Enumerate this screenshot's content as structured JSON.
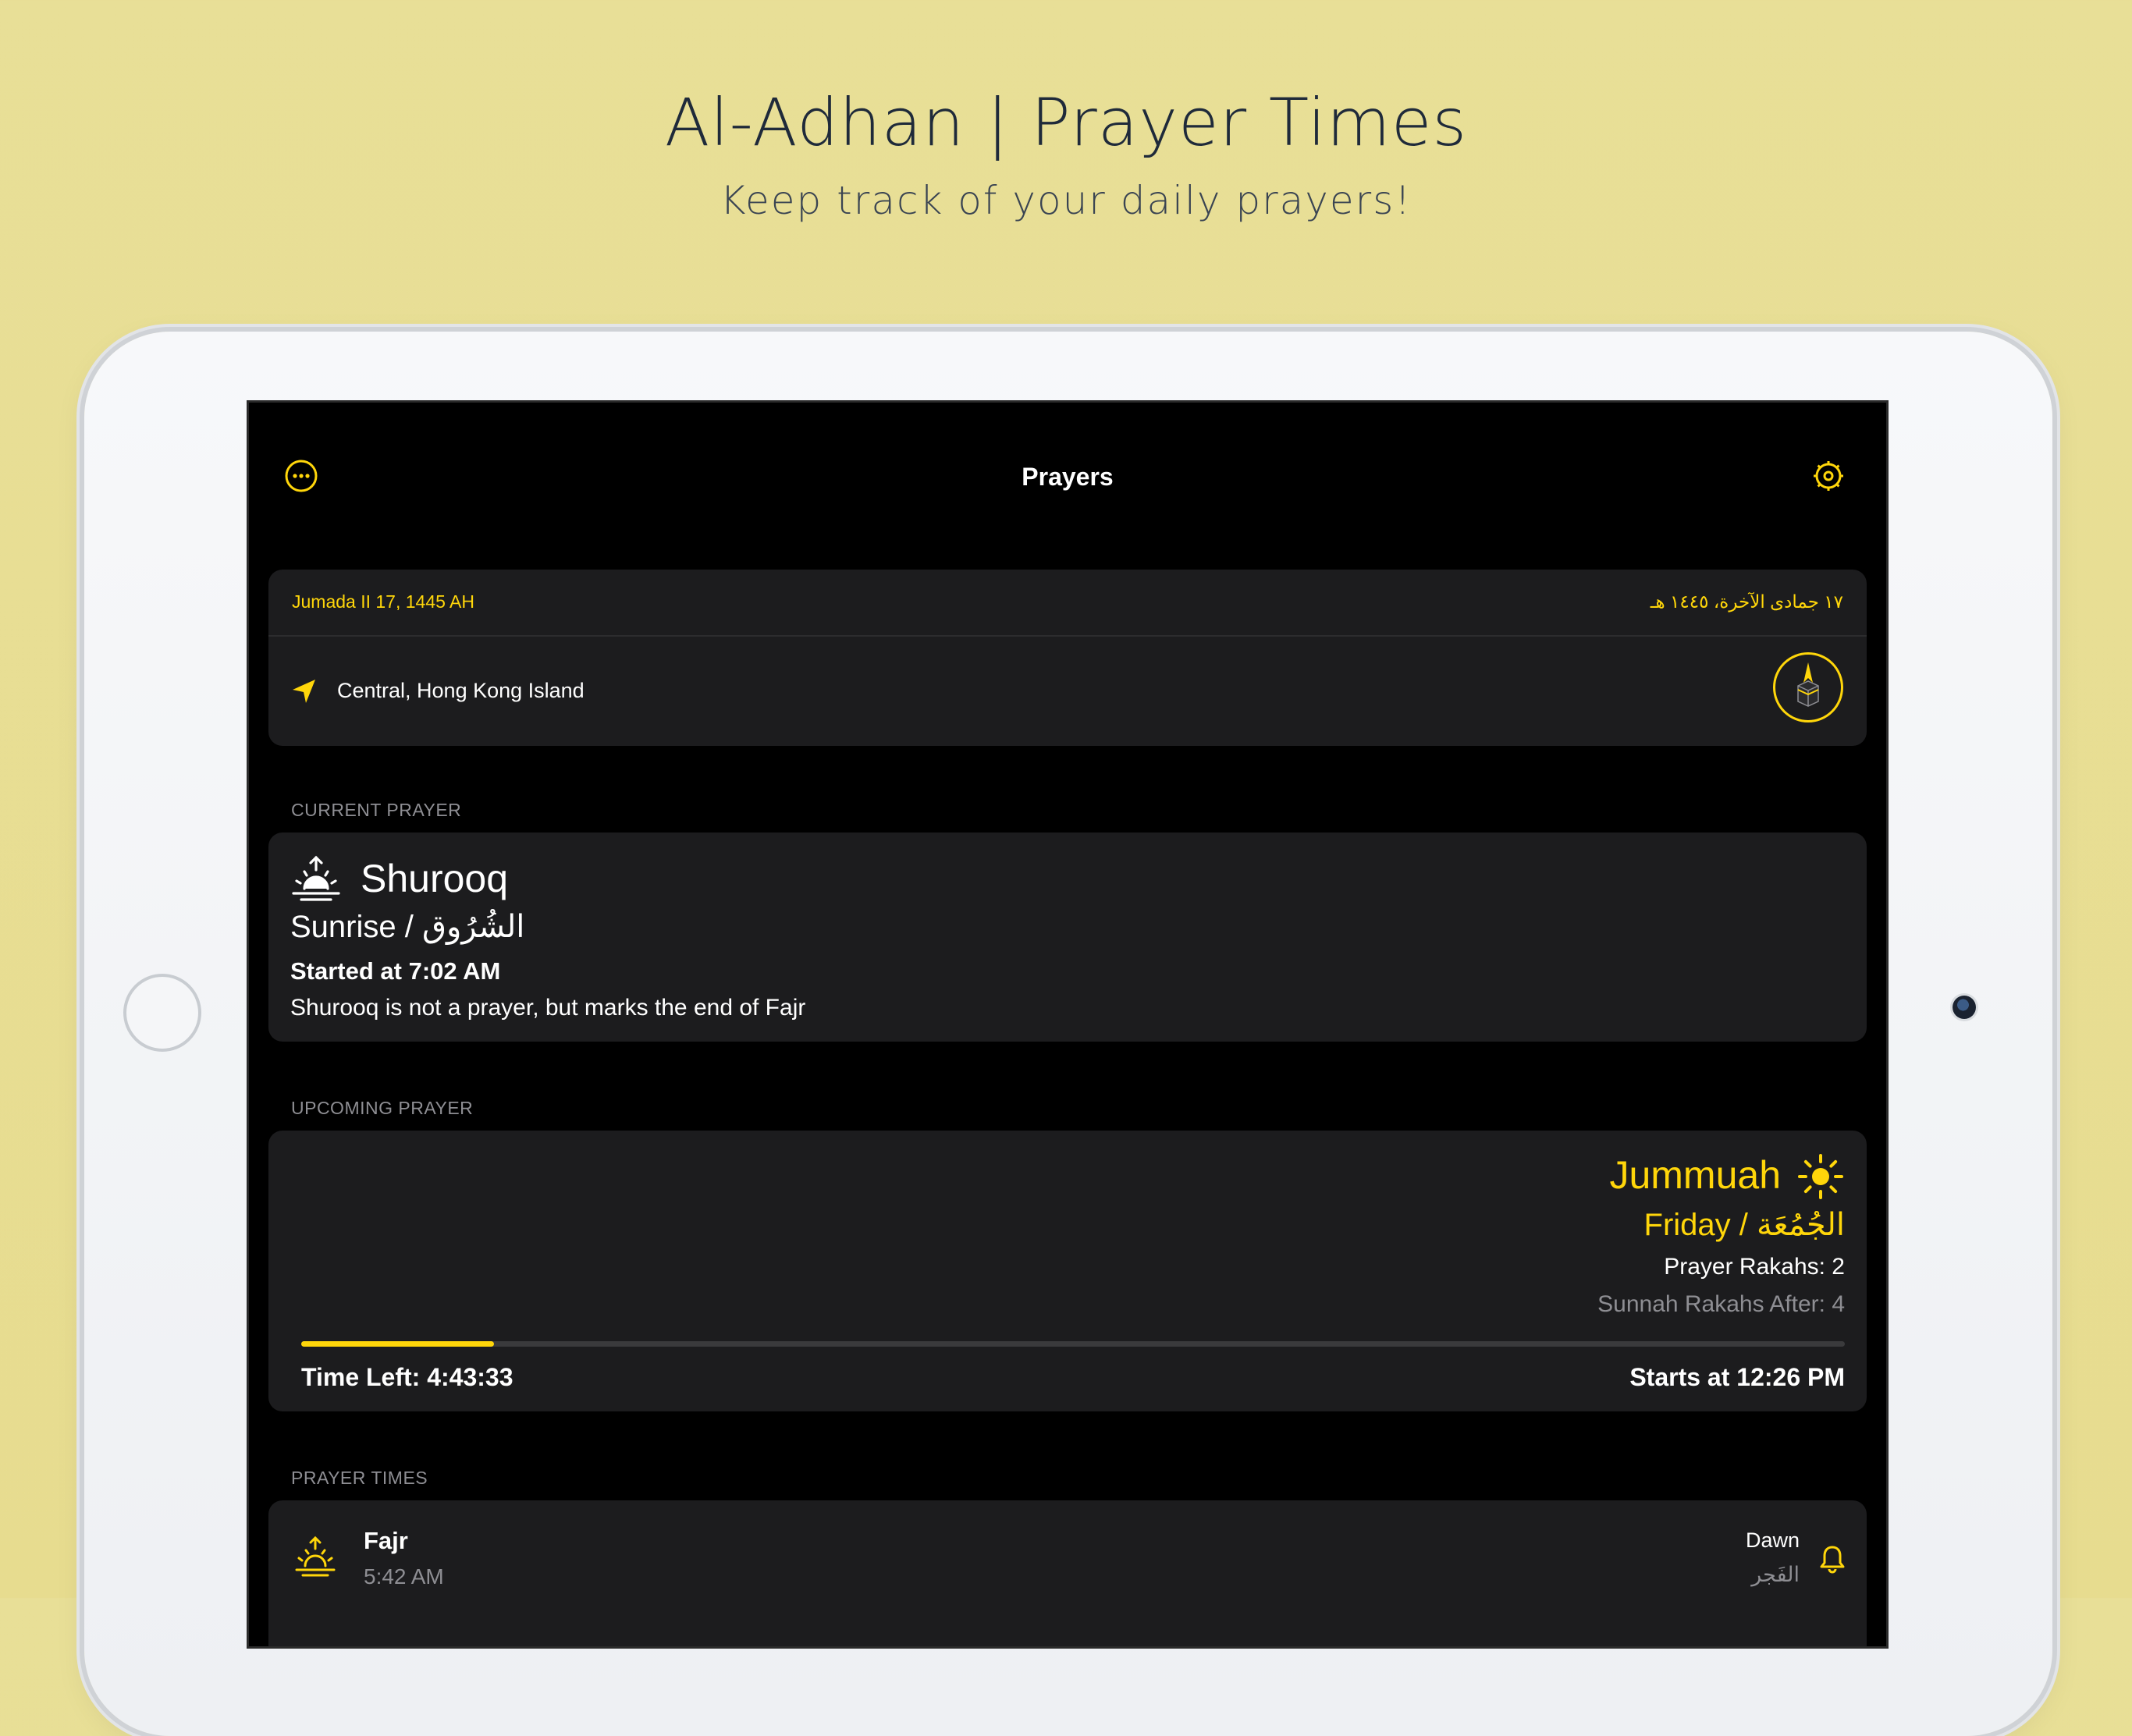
{
  "promo": {
    "title": "Al-Adhan | Prayer Times",
    "subtitle": "Keep track of your daily prayers!"
  },
  "nav": {
    "title": "Prayers",
    "left_icon": "more-circle-icon",
    "right_icon": "settings-gear-icon"
  },
  "info": {
    "hijri_en": "Jumada II 17, 1445 AH",
    "hijri_ar": "١٧ جمادى الآخرة، ١٤٤٥ هـ",
    "location": "Central, Hong Kong Island",
    "location_icon": "location-arrow-icon",
    "qibla_icon": "qibla-kaaba-icon"
  },
  "current": {
    "section_label": "CURRENT PRAYER",
    "icon": "sunrise-icon",
    "name": "Shurooq",
    "subtitle": "Sunrise / الشُرُوق",
    "started": "Started at 7:02 AM",
    "note": "Shurooq is not a prayer, but marks the end of Fajr"
  },
  "upcoming": {
    "section_label": "UPCOMING PRAYER",
    "icon": "sun-icon",
    "name": "Jummuah",
    "subtitle": "Friday / الجُمُعَة",
    "rakahs": "Prayer Rakahs: 2",
    "sunnah": "Sunnah Rakahs After: 4",
    "progress": 0.125,
    "time_left": "Time Left: 4:43:33",
    "starts_at": "Starts at 12:26 PM"
  },
  "prayer_times": {
    "section_label": "PRAYER TIMES",
    "rows": [
      {
        "name": "Fajr",
        "time": "5:42 AM",
        "en": "Dawn",
        "ar": "الفَجر",
        "icon": "dawn-icon",
        "bell_icon": "bell-icon"
      }
    ]
  },
  "colors": {
    "accent": "#ffd60a",
    "background": "#000000",
    "card": "#1c1c1e",
    "secondary_text": "#8e8e93"
  }
}
